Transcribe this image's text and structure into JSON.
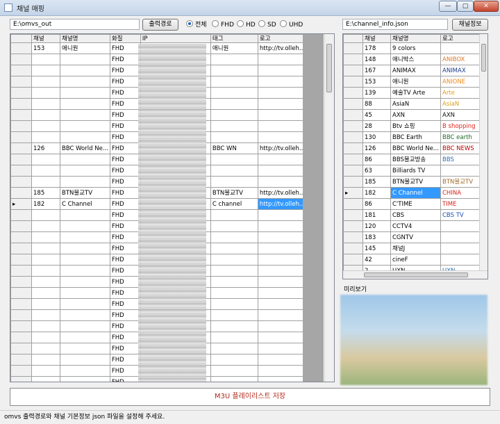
{
  "window": {
    "title": "채널 매핑",
    "min": "—",
    "max": "▢",
    "close": "✕"
  },
  "toolbar": {
    "output_path": "E:\\omvs_out",
    "output_button": "출력경로",
    "filters": [
      "전체",
      "FHD",
      "HD",
      "SD",
      "UHD"
    ],
    "selected_filter": "전체",
    "json_path": "E:\\channel_info.json",
    "json_button": "채널정보"
  },
  "left_grid": {
    "headers": [
      "채널",
      "채널명",
      "화질",
      "IP",
      "태그",
      "로고"
    ],
    "rows": [
      {
        "ch": "153",
        "name": "애니원",
        "q": "FHD",
        "tag": "애니원",
        "logo": "http://tv.olleh...."
      },
      {
        "ch": "",
        "name": "",
        "q": "FHD",
        "tag": "",
        "logo": ""
      },
      {
        "ch": "",
        "name": "",
        "q": "FHD",
        "tag": "",
        "logo": ""
      },
      {
        "ch": "",
        "name": "",
        "q": "FHD",
        "tag": "",
        "logo": ""
      },
      {
        "ch": "",
        "name": "",
        "q": "FHD",
        "tag": "",
        "logo": ""
      },
      {
        "ch": "",
        "name": "",
        "q": "FHD",
        "tag": "",
        "logo": ""
      },
      {
        "ch": "",
        "name": "",
        "q": "FHD",
        "tag": "",
        "logo": ""
      },
      {
        "ch": "",
        "name": "",
        "q": "FHD",
        "tag": "",
        "logo": ""
      },
      {
        "ch": "",
        "name": "",
        "q": "FHD",
        "tag": "",
        "logo": ""
      },
      {
        "ch": "126",
        "name": "BBC World Ne...",
        "q": "FHD",
        "tag": "BBC WN",
        "logo": "http://tv.olleh...."
      },
      {
        "ch": "",
        "name": "",
        "q": "FHD",
        "tag": "",
        "logo": ""
      },
      {
        "ch": "",
        "name": "",
        "q": "FHD",
        "tag": "",
        "logo": ""
      },
      {
        "ch": "",
        "name": "",
        "q": "FHD",
        "tag": "",
        "logo": ""
      },
      {
        "ch": "185",
        "name": "BTN불교TV",
        "q": "FHD",
        "tag": "BTN불교TV",
        "logo": "http://tv.olleh...."
      },
      {
        "ch": "182",
        "name": "C Channel",
        "q": "FHD",
        "tag": "C channel",
        "logo": "http://tv.olleh...."
      },
      {
        "ch": "",
        "name": "",
        "q": "FHD",
        "tag": "",
        "logo": ""
      },
      {
        "ch": "",
        "name": "",
        "q": "FHD",
        "tag": "",
        "logo": ""
      },
      {
        "ch": "",
        "name": "",
        "q": "FHD",
        "tag": "",
        "logo": ""
      },
      {
        "ch": "",
        "name": "",
        "q": "FHD",
        "tag": "",
        "logo": ""
      },
      {
        "ch": "",
        "name": "",
        "q": "FHD",
        "tag": "",
        "logo": ""
      },
      {
        "ch": "",
        "name": "",
        "q": "FHD",
        "tag": "",
        "logo": ""
      },
      {
        "ch": "",
        "name": "",
        "q": "FHD",
        "tag": "",
        "logo": ""
      },
      {
        "ch": "",
        "name": "",
        "q": "FHD",
        "tag": "",
        "logo": ""
      },
      {
        "ch": "",
        "name": "",
        "q": "FHD",
        "tag": "",
        "logo": ""
      },
      {
        "ch": "",
        "name": "",
        "q": "FHD",
        "tag": "",
        "logo": ""
      },
      {
        "ch": "",
        "name": "",
        "q": "FHD",
        "tag": "",
        "logo": ""
      },
      {
        "ch": "",
        "name": "",
        "q": "FHD",
        "tag": "",
        "logo": ""
      },
      {
        "ch": "",
        "name": "",
        "q": "FHD",
        "tag": "",
        "logo": ""
      },
      {
        "ch": "",
        "name": "",
        "q": "FHD",
        "tag": "",
        "logo": ""
      },
      {
        "ch": "",
        "name": "",
        "q": "FHD",
        "tag": "",
        "logo": ""
      },
      {
        "ch": "",
        "name": "",
        "q": "FHD",
        "tag": "",
        "logo": ""
      }
    ],
    "selected_row": 14,
    "current_marker": "▸"
  },
  "right_grid": {
    "headers": [
      "채널",
      "채널명",
      "로고"
    ],
    "rows": [
      {
        "ch": "178",
        "name": "9 colors",
        "logo": ""
      },
      {
        "ch": "148",
        "name": "애니박스",
        "logo": "ANIBOX"
      },
      {
        "ch": "167",
        "name": "ANIMAX",
        "logo": "ANIMAX"
      },
      {
        "ch": "153",
        "name": "애니원",
        "logo": "ANIONE"
      },
      {
        "ch": "139",
        "name": "예술TV Arte",
        "logo": "Arte"
      },
      {
        "ch": "88",
        "name": "AsiaN",
        "logo": "AsiaN"
      },
      {
        "ch": "45",
        "name": "AXN",
        "logo": "AXN"
      },
      {
        "ch": "28",
        "name": "Btv 쇼핑",
        "logo": "B shopping"
      },
      {
        "ch": "130",
        "name": "BBC Earth",
        "logo": "BBC earth"
      },
      {
        "ch": "126",
        "name": "BBC World Ne...",
        "logo": "BBC NEWS"
      },
      {
        "ch": "86",
        "name": "BBS불교방송",
        "logo": "BBS"
      },
      {
        "ch": "63",
        "name": "Billiards TV",
        "logo": ""
      },
      {
        "ch": "185",
        "name": "BTN불교TV",
        "logo": "BTN불교TV"
      },
      {
        "ch": "182",
        "name": "C Channel",
        "logo": "CHINA"
      },
      {
        "ch": "86",
        "name": "C'TIME",
        "logo": "TIME"
      },
      {
        "ch": "181",
        "name": "CBS",
        "logo": "CBS TV"
      },
      {
        "ch": "120",
        "name": "CCTV4",
        "logo": ""
      },
      {
        "ch": "183",
        "name": "CGNTV",
        "logo": ""
      },
      {
        "ch": "145",
        "name": "채널J",
        "logo": ""
      },
      {
        "ch": "42",
        "name": "cineF",
        "logo": ""
      },
      {
        "ch": "2",
        "name": "UXN",
        "logo": "UXN"
      }
    ],
    "selected_row": 13,
    "current_marker": "▸"
  },
  "preview": {
    "label": "미리보기"
  },
  "save_button": "M3U 플레이리스트 저장",
  "status": "omvs 출력경로와 채널 기본정보 json 파일을 설정해 주세요.",
  "colors": {
    "selection": "#3399ff",
    "save_text": "#b22a1a"
  }
}
